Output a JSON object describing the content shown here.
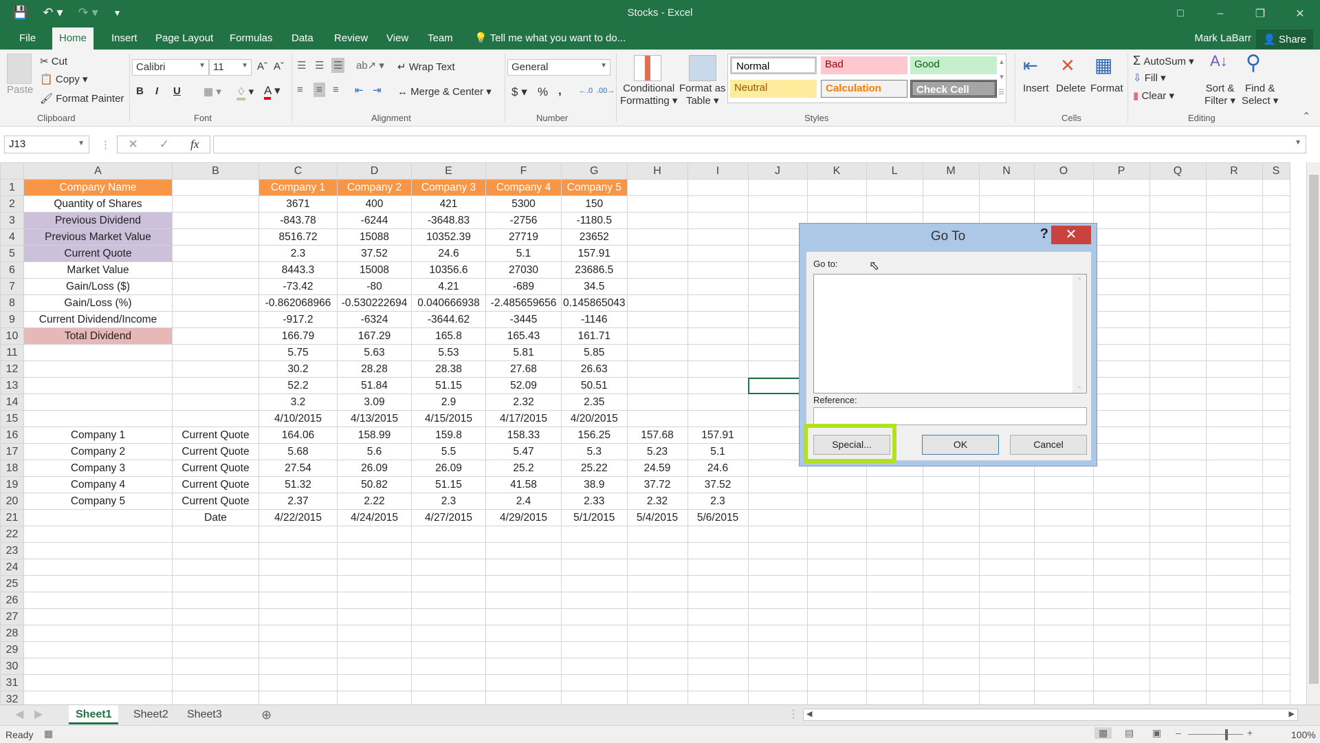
{
  "window": {
    "title": "Stocks - Excel",
    "user": "Mark LaBarr",
    "share_label": "Share"
  },
  "qat": {
    "save_icon": "save-icon",
    "undo_icon": "undo-icon",
    "redo_icon": "redo-icon",
    "customize_icon": "customize-qat-icon"
  },
  "tabs": [
    {
      "label": "File"
    },
    {
      "label": "Home"
    },
    {
      "label": "Insert"
    },
    {
      "label": "Page Layout"
    },
    {
      "label": "Formulas"
    },
    {
      "label": "Data"
    },
    {
      "label": "Review"
    },
    {
      "label": "View"
    },
    {
      "label": "Team"
    }
  ],
  "tell_me": "Tell me what you want to do...",
  "ribbon": {
    "clipboard": {
      "label": "Clipboard",
      "paste": "Paste",
      "cut": "Cut",
      "copy": "Copy",
      "format_painter": "Format Painter"
    },
    "font": {
      "label": "Font",
      "name": "Calibri",
      "size": "11",
      "bold": "B",
      "italic": "I",
      "underline": "U"
    },
    "alignment": {
      "label": "Alignment",
      "wrap_text": "Wrap Text",
      "merge_center": "Merge & Center"
    },
    "number": {
      "label": "Number",
      "format": "General",
      "currency": "$",
      "percent": "%",
      "comma": ","
    },
    "styles": {
      "label": "Styles",
      "conditional": "Conditional",
      "conditional2": "Formatting",
      "format_table": "Format as",
      "format_table2": "Table",
      "cells": [
        {
          "label": "Normal",
          "bg": "#ffffff",
          "fg": "#000000"
        },
        {
          "label": "Bad",
          "bg": "#ffc7ce",
          "fg": "#9c0006"
        },
        {
          "label": "Good",
          "bg": "#c6efce",
          "fg": "#006100"
        },
        {
          "label": "Neutral",
          "bg": "#ffeb9c",
          "fg": "#9c5700"
        },
        {
          "label": "Calculation",
          "bg": "#f2f2f2",
          "fg": "#fa7d00"
        },
        {
          "label": "Check Cell",
          "bg": "#a5a5a5",
          "fg": "#ffffff"
        }
      ]
    },
    "cells": {
      "label": "Cells",
      "insert": "Insert",
      "delete": "Delete",
      "format": "Format"
    },
    "editing": {
      "label": "Editing",
      "autosum": "AutoSum",
      "fill": "Fill",
      "clear": "Clear",
      "sort": "Sort &",
      "sort2": "Filter",
      "find": "Find &",
      "find2": "Select"
    }
  },
  "formula_bar": {
    "name_box": "J13",
    "cancel": "✕",
    "enter": "✓",
    "fx": "fx",
    "value": ""
  },
  "columns": [
    "A",
    "B",
    "C",
    "D",
    "E",
    "F",
    "G",
    "H",
    "I",
    "J",
    "K",
    "L",
    "M",
    "N",
    "O",
    "P",
    "Q",
    "R",
    "S"
  ],
  "rows": [
    [
      "Company Name",
      "",
      "Company 1",
      "Company 2",
      "Company 3",
      "Company 4",
      "Company 5",
      "",
      ""
    ],
    [
      "Quantity of Shares",
      "",
      "3671",
      "400",
      "421",
      "5300",
      "150",
      "",
      ""
    ],
    [
      "Previous Dividend",
      "",
      "-843.78",
      "-6244",
      "-3648.83",
      "-2756",
      "-1180.5",
      "",
      ""
    ],
    [
      "Previous Market Value",
      "",
      "8516.72",
      "15088",
      "10352.39",
      "27719",
      "23652",
      "",
      ""
    ],
    [
      "Current Quote",
      "",
      "2.3",
      "37.52",
      "24.6",
      "5.1",
      "157.91",
      "",
      ""
    ],
    [
      "Market Value",
      "",
      "8443.3",
      "15008",
      "10356.6",
      "27030",
      "23686.5",
      "",
      ""
    ],
    [
      "Gain/Loss ($)",
      "",
      "-73.42",
      "-80",
      "4.21",
      "-689",
      "34.5",
      "",
      ""
    ],
    [
      "Gain/Loss (%)",
      "",
      "-0.862068966",
      "-0.530222694",
      "0.040666938",
      "-2.485659656",
      "0.145865043",
      "",
      ""
    ],
    [
      "Current Dividend/Income",
      "",
      "-917.2",
      "-6324",
      "-3644.62",
      "-3445",
      "-1146",
      "",
      ""
    ],
    [
      "Total Dividend",
      "",
      "166.79",
      "167.29",
      "165.8",
      "165.43",
      "161.71",
      "",
      ""
    ],
    [
      "",
      "",
      "5.75",
      "5.63",
      "5.53",
      "5.81",
      "5.85",
      "",
      ""
    ],
    [
      "",
      "",
      "30.2",
      "28.28",
      "28.38",
      "27.68",
      "26.63",
      "",
      ""
    ],
    [
      "",
      "",
      "52.2",
      "51.84",
      "51.15",
      "52.09",
      "50.51",
      "",
      ""
    ],
    [
      "",
      "",
      "3.2",
      "3.09",
      "2.9",
      "2.32",
      "2.35",
      "",
      ""
    ],
    [
      "",
      "",
      "4/10/2015",
      "4/13/2015",
      "4/15/2015",
      "4/17/2015",
      "4/20/2015",
      "",
      ""
    ],
    [
      "Company 1",
      "Current Quote",
      "164.06",
      "158.99",
      "159.8",
      "158.33",
      "156.25",
      "157.68",
      "157.91"
    ],
    [
      "Company 2",
      "Current Quote",
      "5.68",
      "5.6",
      "5.5",
      "5.47",
      "5.3",
      "5.23",
      "5.1"
    ],
    [
      "Company 3",
      "Current Quote",
      "27.54",
      "26.09",
      "26.09",
      "25.2",
      "25.22",
      "24.59",
      "24.6"
    ],
    [
      "Company 4",
      "Current Quote",
      "51.32",
      "50.82",
      "51.15",
      "41.58",
      "38.9",
      "37.72",
      "37.52"
    ],
    [
      "Company 5",
      "Current Quote",
      "2.37",
      "2.22",
      "2.3",
      "2.4",
      "2.33",
      "2.32",
      "2.3"
    ],
    [
      "",
      "Date",
      "4/22/2015",
      "4/24/2015",
      "4/27/2015",
      "4/29/2015",
      "5/1/2015",
      "5/4/2015",
      "5/6/2015"
    ]
  ],
  "visible_row_count": 32,
  "selected_cell": "J13",
  "sheets": [
    {
      "label": "Sheet1",
      "active": true
    },
    {
      "label": "Sheet2"
    },
    {
      "label": "Sheet3"
    }
  ],
  "status": {
    "ready": "Ready",
    "zoom": "100%"
  },
  "dialog": {
    "title": "Go To",
    "help": "?",
    "close": "✕",
    "goto_label": "Go to:",
    "reference_label": "Reference:",
    "reference_value": "",
    "special": "Special...",
    "ok": "OK",
    "cancel": "Cancel"
  },
  "colors": {
    "accent": "#217346",
    "header_fill": "#f79646",
    "lavender_fill": "#ccc0da",
    "pink_fill": "#e6b8b7",
    "highlight": "#b1e21d"
  }
}
